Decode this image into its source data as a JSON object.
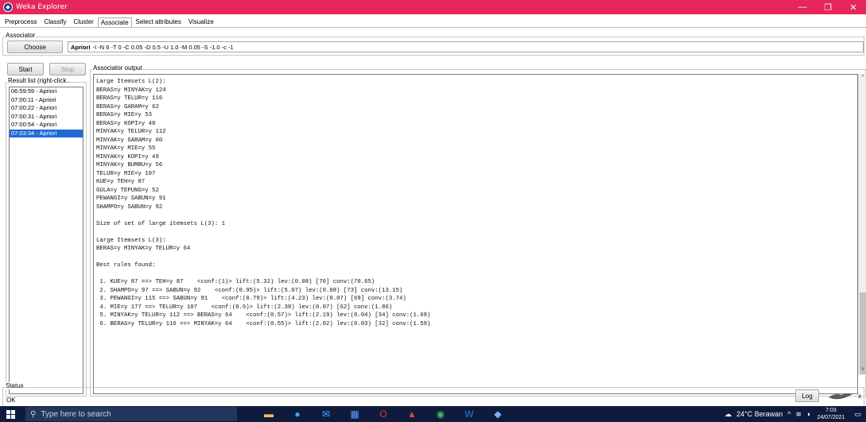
{
  "window": {
    "title": "Weka Explorer",
    "minimize": "—",
    "maximize": "❐",
    "close": "✕"
  },
  "tabs": [
    "Preprocess",
    "Classify",
    "Cluster",
    "Associate",
    "Select attributes",
    "Visualize"
  ],
  "associator": {
    "section_label": "Associator",
    "choose_label": "Choose",
    "algorithm": "Apriori",
    "options": "-I -N 6 -T 0 -C 0.05 -D 0.5 -U 1.0 -M 0.05 -S -1.0 -c -1"
  },
  "controls": {
    "start_label": "Start",
    "stop_label": "Stop"
  },
  "result_list": {
    "label": "Result list (right-click...",
    "items": [
      "06:59:59 - Apriori",
      "07:00:11 - Apriori",
      "07:00:22 - Apriori",
      "07:00:31 - Apriori",
      "07:00:54 - Apriori",
      "07:03:34 - Apriori"
    ],
    "selected_index": 5
  },
  "output": {
    "label": "Associator output",
    "lines": [
      "Large Itemsets L(2):",
      "BERAS=y MINYAK=y 124",
      "BERAS=y TELUR=y 116",
      "BERAS=y GARAM=y 62",
      "BERAS=y MIE=y 53",
      "BERAS=y KOPI=y 48",
      "MINYAK=y TELUR=y 112",
      "MINYAK=y GARAM=y 60",
      "MINYAK=y MIE=y 55",
      "MINYAK=y KOPI=y 49",
      "MINYAK=y BUMBU=y 56",
      "TELUR=y MIE=y 107",
      "KUE=y TEH=y 87",
      "GULA=y TEPUNG=y 52",
      "PEWANGI=y SABUN=y 91",
      "SHAMPO=y SABUN=y 92",
      "",
      "Size of set of large itemsets L(3): 1",
      "",
      "Large Itemsets L(3):",
      "BERAS=y MINYAK=y TELUR=y 64",
      "",
      "Best rules found:",
      "",
      " 1. KUE=y 87 ==> TEH=y 87    <conf:(1)> lift:(5.32) lev:(0.08) [70] conv:(70.65)",
      " 2. SHAMPO=y 97 ==> SABUN=y 92    <conf:(0.95)> lift:(5.07) lev:(0.08) [73] conv:(13.15)",
      " 3. PEWANGI=y 115 ==> SABUN=y 91    <conf:(0.79)> lift:(4.23) lev:(0.07) [69] conv:(3.74)",
      " 4. MIE=y 177 ==> TELUR=y 107    <conf:(0.6)> lift:(2.38) lev:(0.07) [62] conv:(1.86)",
      " 5. MINYAK=y TELUR=y 112 ==> BERAS=y 64    <conf:(0.57)> lift:(2.19) lev:(0.04) [34] conv:(1.69)",
      " 6. BERAS=y TELUR=y 116 ==> MINYAK=y 64    <conf:(0.55)> lift:(2.02) lev:(0.03) [32] conv:(1.59)"
    ]
  },
  "status": {
    "label": "Status",
    "text": "OK",
    "log_label": "Log",
    "x_label": "x"
  },
  "taskbar": {
    "search_placeholder": "Type here to search",
    "weather": "24°C  Berawan",
    "time": "7:03",
    "date": "24/07/2021"
  },
  "colors": {
    "titlebar": "#e6265c",
    "selection": "#1f6bd6",
    "taskbar": "#0f1b3d"
  }
}
